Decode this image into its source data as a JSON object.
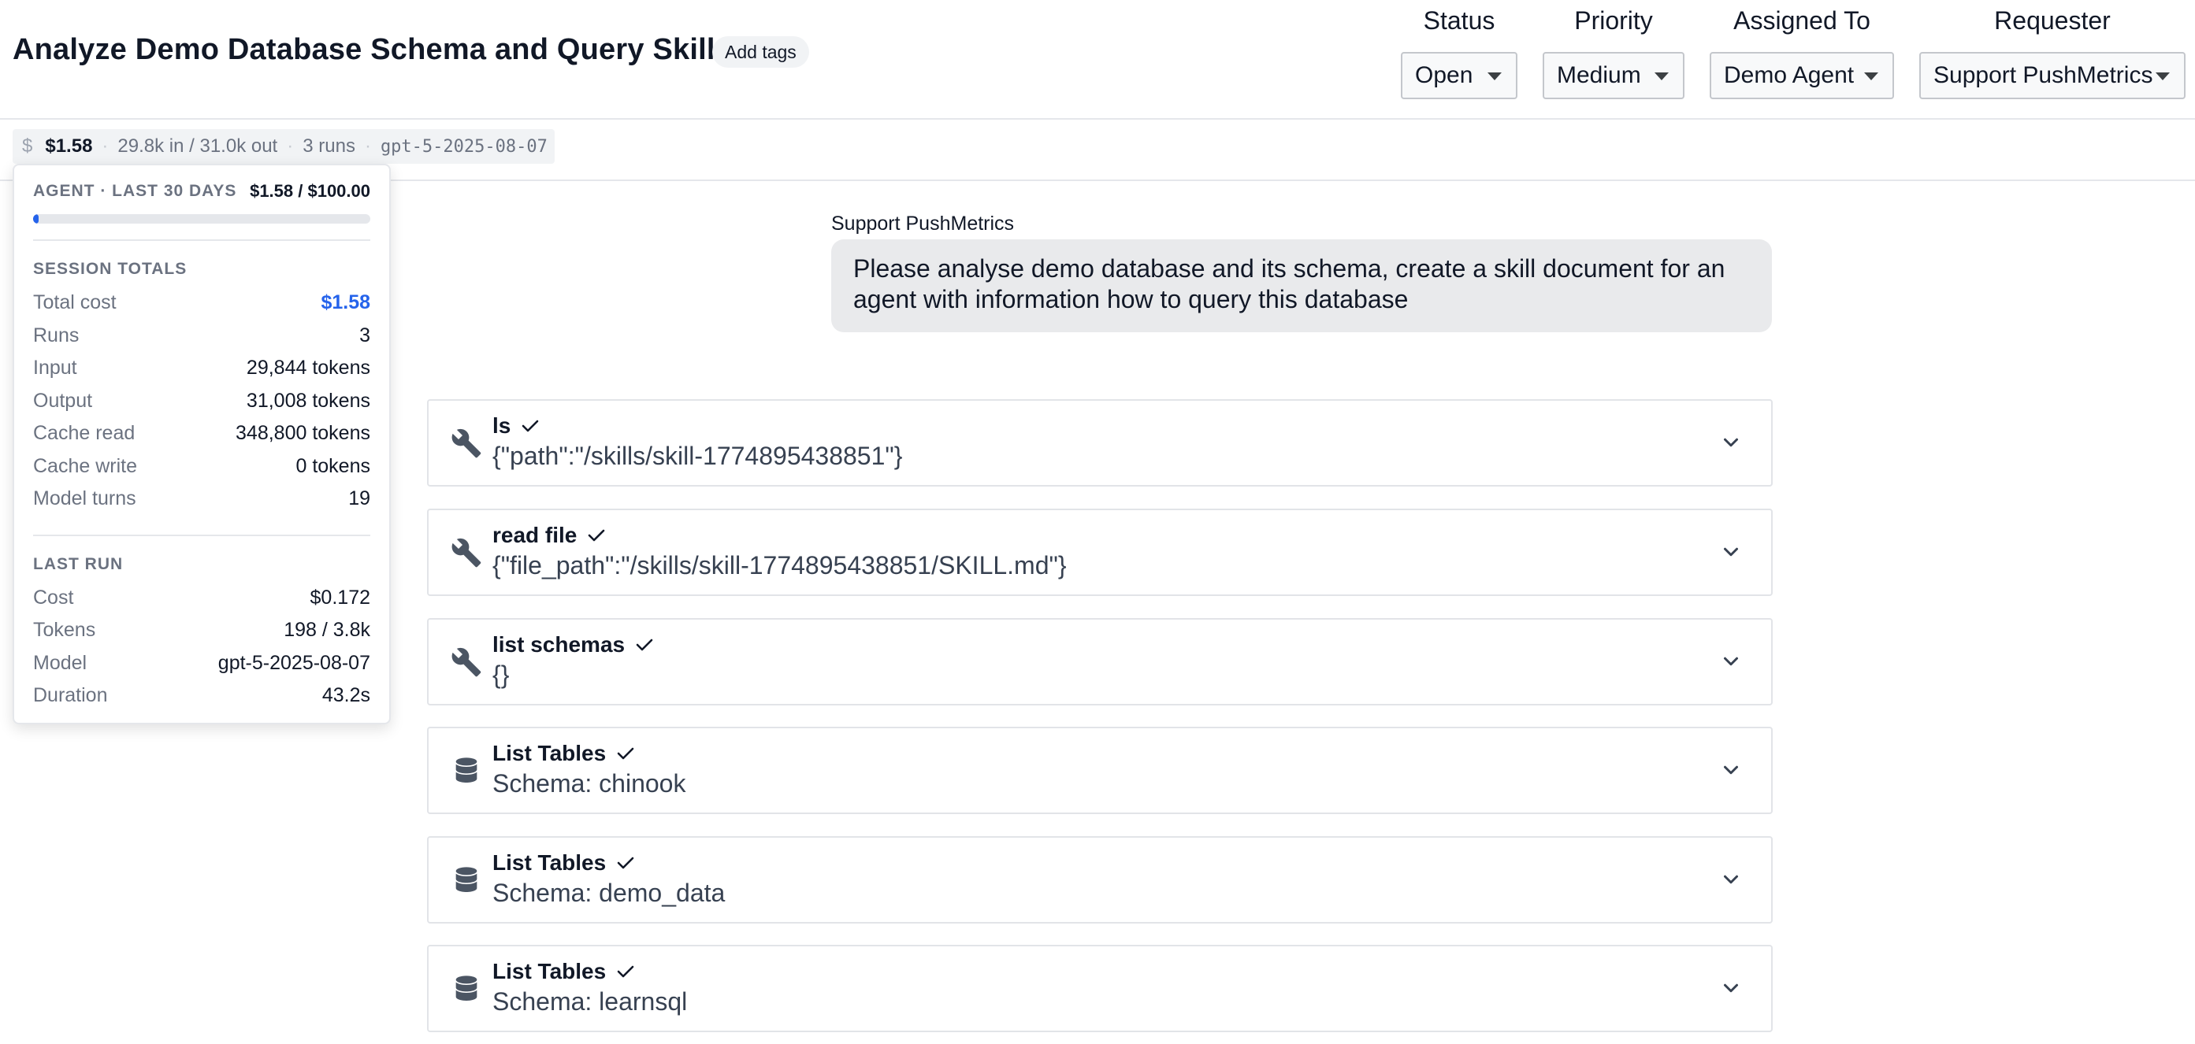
{
  "header": {
    "title": "Analyze Demo Database Schema and Query Skills",
    "add_tags": "Add tags",
    "fields": {
      "status": {
        "label": "Status",
        "value": "Open"
      },
      "priority": {
        "label": "Priority",
        "value": "Medium"
      },
      "assigned": {
        "label": "Assigned To",
        "value": "Demo Agent"
      },
      "requester": {
        "label": "Requester",
        "value": "Support PushMetrics"
      }
    }
  },
  "usage": {
    "currency_icon": "$",
    "cost": "$1.58",
    "tokens": "29.8k in / 31.0k out",
    "runs": "3 runs",
    "model": "gpt-5-2025-08-07"
  },
  "popover": {
    "budget_label": "AGENT · LAST 30 DAYS",
    "budget_value": "$1.58 / $100.00",
    "budget_fraction": 0.0158,
    "session_title": "SESSION TOTALS",
    "session": [
      {
        "k": "Total cost",
        "v": "$1.58"
      },
      {
        "k": "Runs",
        "v": "3"
      },
      {
        "k": "Input",
        "v": "29,844 tokens"
      },
      {
        "k": "Output",
        "v": "31,008 tokens"
      },
      {
        "k": "Cache read",
        "v": "348,800 tokens"
      },
      {
        "k": "Cache write",
        "v": "0 tokens"
      },
      {
        "k": "Model turns",
        "v": "19"
      }
    ],
    "last_title": "LAST RUN",
    "last": [
      {
        "k": "Cost",
        "v": "$0.172"
      },
      {
        "k": "Tokens",
        "v": "198 / 3.8k"
      },
      {
        "k": "Model",
        "v": "gpt-5-2025-08-07"
      },
      {
        "k": "Duration",
        "v": "43.2s"
      }
    ]
  },
  "message": {
    "sender": "Support PushMetrics",
    "text": "Please analyse demo database and its schema, create a skill document for an agent with information how to query this database"
  },
  "tools": [
    {
      "name": "ls",
      "arg": "{\"path\":\"/skills/skill-1774895438851\"}",
      "icon": "wrench-icon"
    },
    {
      "name": "read file",
      "arg": "{\"file_path\":\"/skills/skill-1774895438851/SKILL.md\"}",
      "icon": "wrench-icon"
    },
    {
      "name": "list schemas",
      "arg": "{}",
      "icon": "wrench-icon"
    },
    {
      "name": "List Tables",
      "arg": "Schema: chinook",
      "icon": "database-icon"
    },
    {
      "name": "List Tables",
      "arg": "Schema: demo_data",
      "icon": "database-icon"
    },
    {
      "name": "List Tables",
      "arg": "Schema: learnsql",
      "icon": "database-icon"
    }
  ],
  "colors": {
    "accent": "#2563eb",
    "check": "#111827"
  }
}
